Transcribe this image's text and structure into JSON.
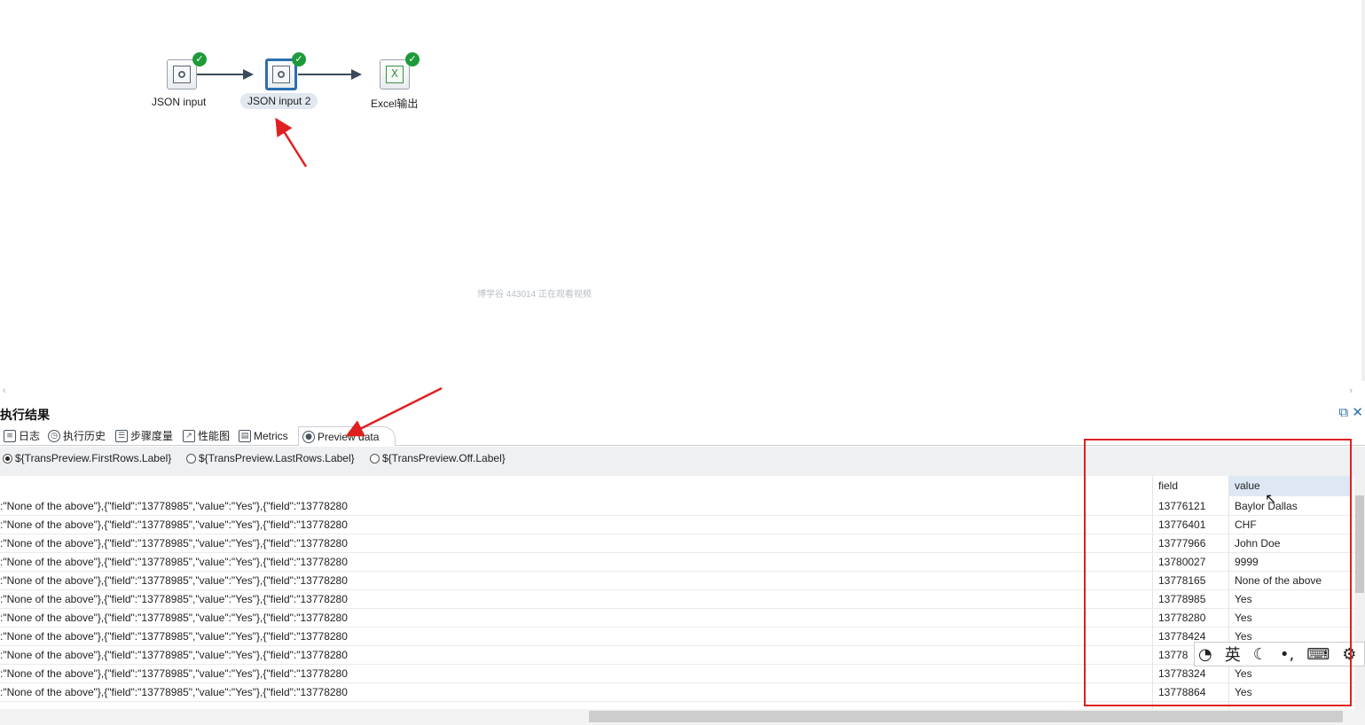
{
  "canvas": {
    "steps": [
      {
        "label": "JSON input",
        "icon": "json-input-icon"
      },
      {
        "label": "JSON input 2",
        "icon": "json-input-icon"
      },
      {
        "label": "Excel输出",
        "icon": "excel-output-icon"
      }
    ],
    "watermark": "博学谷 443014 正在观看视频"
  },
  "results": {
    "title": "执行结果",
    "tabs": [
      "日志",
      "执行历史",
      "步骤度量",
      "性能图",
      "Metrics",
      "Preview data"
    ],
    "active_tab": "Preview data",
    "radios": [
      {
        "label": "${TransPreview.FirstRows.Label}",
        "checked": true
      },
      {
        "label": "${TransPreview.LastRows.Label}",
        "checked": false
      },
      {
        "label": "${TransPreview.Off.Label}",
        "checked": false
      }
    ],
    "columns": [
      "",
      "field",
      "value"
    ],
    "rows": [
      {
        "json": ":\"None of the above\"},{\"field\":\"13778985\",\"value\":\"Yes\"},{\"field\":\"13778280",
        "field": "13776121",
        "value": "Baylor Dallas"
      },
      {
        "json": ":\"None of the above\"},{\"field\":\"13778985\",\"value\":\"Yes\"},{\"field\":\"13778280",
        "field": "13776401",
        "value": "CHF"
      },
      {
        "json": ":\"None of the above\"},{\"field\":\"13778985\",\"value\":\"Yes\"},{\"field\":\"13778280",
        "field": "13777966",
        "value": "John Doe"
      },
      {
        "json": ":\"None of the above\"},{\"field\":\"13778985\",\"value\":\"Yes\"},{\"field\":\"13778280",
        "field": "13780027",
        "value": "9999"
      },
      {
        "json": ":\"None of the above\"},{\"field\":\"13778985\",\"value\":\"Yes\"},{\"field\":\"13778280",
        "field": "13778165",
        "value": "None of the above"
      },
      {
        "json": ":\"None of the above\"},{\"field\":\"13778985\",\"value\":\"Yes\"},{\"field\":\"13778280",
        "field": "13778985",
        "value": "Yes"
      },
      {
        "json": ":\"None of the above\"},{\"field\":\"13778985\",\"value\":\"Yes\"},{\"field\":\"13778280",
        "field": "13778280",
        "value": "Yes"
      },
      {
        "json": ":\"None of the above\"},{\"field\":\"13778985\",\"value\":\"Yes\"},{\"field\":\"13778280",
        "field": "13778424",
        "value": "Yes"
      },
      {
        "json": ":\"None of the above\"},{\"field\":\"13778985\",\"value\":\"Yes\"},{\"field\":\"13778280",
        "field": "13778",
        "value": ""
      },
      {
        "json": ":\"None of the above\"},{\"field\":\"13778985\",\"value\":\"Yes\"},{\"field\":\"13778280",
        "field": "13778324",
        "value": "Yes"
      },
      {
        "json": ":\"None of the above\"},{\"field\":\"13778985\",\"value\":\"Yes\"},{\"field\":\"13778280",
        "field": "13778864",
        "value": "Yes"
      }
    ]
  },
  "ime_bar": {
    "lang": "英"
  },
  "colors": {
    "annotation": "#e02020",
    "selected_border": "#2c6fb0",
    "success": "#1f9a3a"
  }
}
